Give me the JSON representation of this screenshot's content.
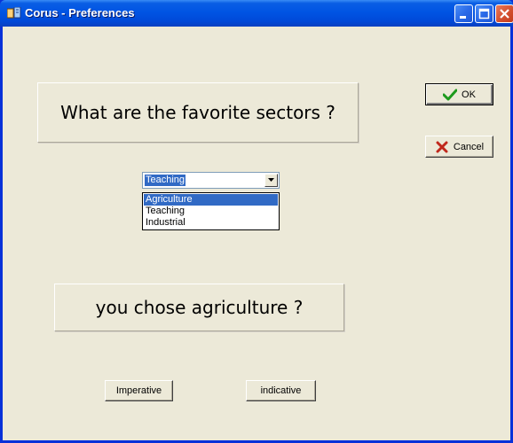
{
  "window": {
    "title": "Corus - Preferences",
    "icon": "app-icon",
    "controls": [
      "minimize-icon",
      "maximize-icon",
      "close-icon"
    ]
  },
  "question": {
    "text": "What are the favorite sectors ?"
  },
  "answer": {
    "text": "you chose agriculture ?"
  },
  "buttons": {
    "ok": {
      "label": "OK",
      "icon": "checkmark-icon"
    },
    "cancel": {
      "label": "Cancel",
      "icon": "x-icon"
    },
    "imperative": {
      "label": "Imperative"
    },
    "indicative": {
      "label": "indicative"
    }
  },
  "sector_select": {
    "value": "Teaching",
    "options": [
      "Agriculture",
      "Teaching",
      "Industrial"
    ],
    "highlighted": "Agriculture"
  },
  "colors": {
    "titlebar": "#0054e3",
    "client": "#ece9d8",
    "selection": "#316ac5",
    "ok_check": "#1d9a1d",
    "cancel_x": "#c0281c"
  }
}
